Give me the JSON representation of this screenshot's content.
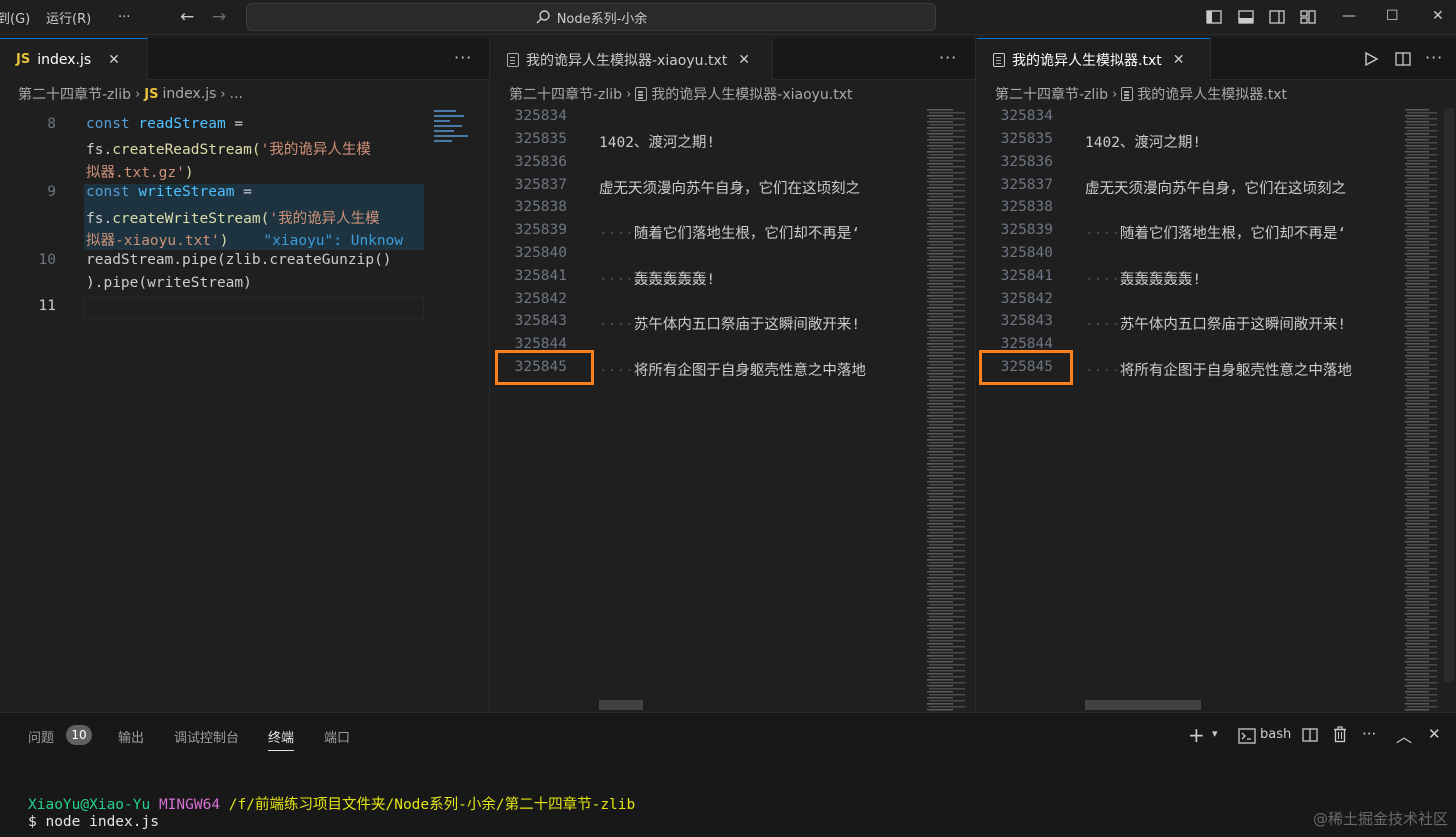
{
  "titlebar": {
    "menu_goto": "转到(G)",
    "menu_run": "运行(R)",
    "menu_more": "···",
    "back": "←",
    "forward": "→",
    "search_text": "Node系列-小余",
    "minimize": "—",
    "maximize": "☐",
    "close": "✕"
  },
  "pane1": {
    "tab_badge": "JS",
    "tab_label": "index.js",
    "breadcrumb_folder": "第二十四章节-zlib",
    "breadcrumb_badge": "JS",
    "breadcrumb_file": "index.js",
    "breadcrumb_more": "...",
    "lines": {
      "n8": "8",
      "n9": "9",
      "n10": "10",
      "n11": "11",
      "l8a_kw": "const",
      "l8a_var": "readStream",
      "l8a_op": " =",
      "l8b_obj": "fs.",
      "l8b_fn": "createReadStream",
      "l8b_p": "(",
      "l8b_str": "'我的诡异人生模",
      "l8c_str": "拟器.txt.gz'",
      "l8c_p": ")",
      "l9a_kw": "const",
      "l9a_var": "writeStream",
      "l9a_op": " =",
      "l9b_obj": "fs.",
      "l9b_fn": "createWriteStream",
      "l9b_p": "(",
      "l9b_str": "'我的诡异人生模",
      "l9c_str": "拟器-xiaoyu.txt'",
      "l9c_p": ")",
      "l9c_hint": "    \"xiaoyu\": Unknow",
      "l10a": "readStream.pipe(zlib.createGunzip()",
      "l10b": ").pipe(writeStream)"
    }
  },
  "pane2": {
    "tab_label": "我的诡异人生模拟器-xiaoyu.txt",
    "breadcrumb_folder": "第二十四章节-zlib",
    "breadcrumb_file": "我的诡异人生模拟器-xiaoyu.txt"
  },
  "pane3": {
    "tab_label": "我的诡异人生模拟器.txt",
    "breadcrumb_folder": "第二十四章节-zlib",
    "breadcrumb_file": "我的诡异人生模拟器.txt"
  },
  "text_lines": {
    "n34": "325834",
    "n35": "325835",
    "n36": "325836",
    "n37": "325837",
    "n38": "325838",
    "n39": "325839",
    "n40": "325840",
    "n41": "325841",
    "n42": "325842",
    "n43": "325843",
    "n44": "325844",
    "n45": "325845",
    "t35": "1402、渡河之期!",
    "t37": "虚无天须漫向苏午自身，它们在这顷刻之",
    "t39": "随着它们落地生根，它们却不再是‘",
    "t41": "轰轰轰轰轰!",
    "t43": "苏午体内五口祭庙于这瞬间敞开来!",
    "t45": "将所有企图于自身躯壳性意之中落地",
    "dots": "····"
  },
  "panel": {
    "tab_problems": "问题",
    "problems_count": "10",
    "tab_output": "输出",
    "tab_debug": "调试控制台",
    "tab_terminal": "终端",
    "tab_ports": "端口",
    "add": "+",
    "shell": "bash",
    "more": "···",
    "term_user": "XiaoYu@Xiao-Yu",
    "term_host": "MINGW64",
    "term_path": "/f/前端练习项目文件夹/Node系列-小余/第二十四章节-zlib",
    "term_prompt": "$",
    "term_cmd": "node index.js"
  },
  "watermark": "@稀土掘金技术社区"
}
